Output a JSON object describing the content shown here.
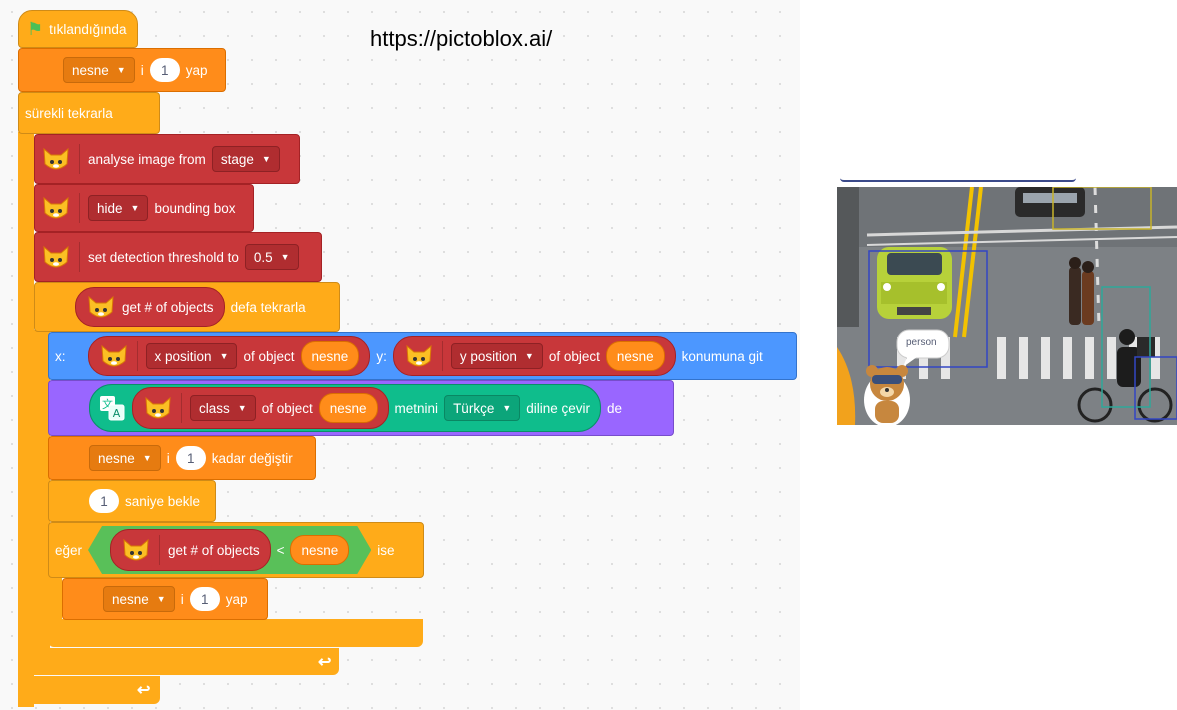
{
  "url_caption": "https://pictoblox.ai/",
  "blocks": {
    "when_flag_clicked": "tıklandığında",
    "set_var_1": {
      "var": "nesne",
      "mid": "i",
      "value": "1",
      "suffix": "yap"
    },
    "forever": "sürekli tekrarla",
    "analyse": {
      "label": "analyse image from",
      "source": "stage"
    },
    "hide_box": {
      "option": "hide",
      "label": "bounding box"
    },
    "threshold": {
      "label": "set detection threshold to",
      "value": "0.5"
    },
    "repeat": {
      "reporter": "get # of objects",
      "suffix": "defa tekrarla"
    },
    "goto": {
      "x_label": "x:",
      "x_option": "x position",
      "of_object": "of object",
      "x_var": "nesne",
      "y_label": "y:",
      "y_option": "y position",
      "y_var": "nesne",
      "suffix": "konumuna git"
    },
    "say": {
      "option": "class",
      "of_object": "of object",
      "var": "nesne",
      "text_label": "metnini",
      "language": "Türkçe",
      "translate_label": "diline çevir",
      "suffix": "de"
    },
    "change": {
      "var": "nesne",
      "mid": "i",
      "value": "1",
      "suffix": "kadar değiştir"
    },
    "wait": {
      "value": "1",
      "suffix": "saniye bekle"
    },
    "if_block": {
      "prefix": "eğer",
      "reporter": "get # of objects",
      "op": "<",
      "var": "nesne",
      "suffix": "ise"
    },
    "set_var_2": {
      "var": "nesne",
      "mid": "i",
      "value": "1",
      "suffix": "yap"
    }
  },
  "stage": {
    "detection_label": "person"
  },
  "colors": {
    "events": "#ffab19",
    "variables": "#ff8c1a",
    "control": "#ffab19",
    "ml": "#c8373a",
    "motion": "#4c97ff",
    "looks": "#9966ff",
    "operators": "#59c059",
    "translate": "#0fbd8c"
  },
  "icons": {
    "flag": "green-flag-icon",
    "extension": "cat-face-icon",
    "translate": "translate-icon",
    "dropdown": "caret-down-icon",
    "loop": "loop-arrow-icon"
  }
}
